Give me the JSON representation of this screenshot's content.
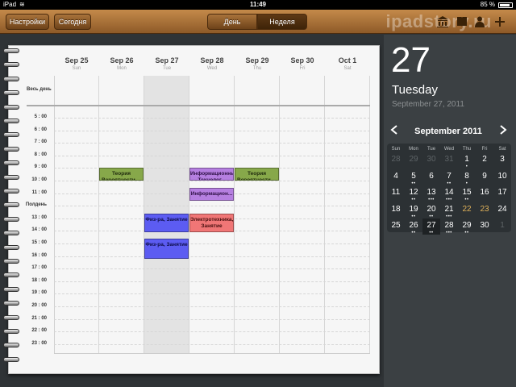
{
  "status": {
    "carrier": "iPad",
    "time": "11:49",
    "battery": "85 %"
  },
  "toolbar": {
    "settings_label": "Настройки",
    "today_label": "Сегодня",
    "day_label": "День",
    "week_label": "Неделя",
    "watermark": "ipadstory.ru"
  },
  "week": {
    "days": [
      {
        "date": "Sep 25",
        "name": "Sun"
      },
      {
        "date": "Sep 26",
        "name": "Mon"
      },
      {
        "date": "Sep 27",
        "name": "Tue"
      },
      {
        "date": "Sep 28",
        "name": "Wed"
      },
      {
        "date": "Sep 29",
        "name": "Thu"
      },
      {
        "date": "Sep 30",
        "name": "Fri"
      },
      {
        "date": "Oct 1",
        "name": "Sat"
      }
    ],
    "allday_label": "Весь день",
    "hours": [
      "5 : 00",
      "6 : 00",
      "7 : 00",
      "8 : 00",
      "9 : 00",
      "10 : 00",
      "11 : 00",
      "Полдень",
      "13 : 00",
      "14 : 00",
      "15 : 00",
      "16 : 00",
      "17 : 00",
      "18 : 00",
      "19 : 00",
      "20 : 00",
      "21 : 00",
      "22 : 00",
      "23 : 00"
    ],
    "events": [
      {
        "title": "Теория Вероятности,...",
        "day": 1,
        "start": 9,
        "end": 10,
        "color": "green"
      },
      {
        "title": "Информационные Технолог...",
        "day": 3,
        "start": 9,
        "end": 10,
        "color": "purple"
      },
      {
        "title": "Теория Вероятности,...",
        "day": 4,
        "start": 9,
        "end": 10,
        "color": "green"
      },
      {
        "title": "Информацион...",
        "day": 3,
        "start": 10.6,
        "end": 11.6,
        "color": "purple"
      },
      {
        "title": "Физ-ра, Занятие",
        "day": 2,
        "start": 12.6,
        "end": 14.1,
        "color": "blue"
      },
      {
        "title": "Электротехника, Занятие",
        "day": 3,
        "start": 12.6,
        "end": 14.1,
        "color": "red"
      },
      {
        "title": "Физ-ра, Занятие",
        "day": 2,
        "start": 14.6,
        "end": 16.2,
        "color": "blue"
      }
    ]
  },
  "sidebar": {
    "day_number": "27",
    "weekday": "Tuesday",
    "full_date": "September 27, 2011",
    "month_title": "September 2011",
    "weekdays": [
      "Sun",
      "Mon",
      "Tue",
      "Wed",
      "Thu",
      "Fri",
      "Sat"
    ],
    "weeks": [
      [
        {
          "d": "28",
          "dim": true
        },
        {
          "d": "29",
          "dim": true
        },
        {
          "d": "30",
          "dim": true
        },
        {
          "d": "31",
          "dim": true
        },
        {
          "d": "1",
          "dots": 1
        },
        {
          "d": "2"
        },
        {
          "d": "3"
        }
      ],
      [
        {
          "d": "4"
        },
        {
          "d": "5",
          "dots": 2
        },
        {
          "d": "6"
        },
        {
          "d": "7",
          "dots": 2
        },
        {
          "d": "8",
          "dots": 1
        },
        {
          "d": "9"
        },
        {
          "d": "10"
        }
      ],
      [
        {
          "d": "11"
        },
        {
          "d": "12",
          "dots": 2
        },
        {
          "d": "13",
          "dots": 3
        },
        {
          "d": "14",
          "dots": 3
        },
        {
          "d": "15",
          "dots": 2
        },
        {
          "d": "16"
        },
        {
          "d": "17"
        }
      ],
      [
        {
          "d": "18"
        },
        {
          "d": "19",
          "dots": 2
        },
        {
          "d": "20",
          "dots": 2
        },
        {
          "d": "21",
          "dots": 3
        },
        {
          "d": "22",
          "accent": true
        },
        {
          "d": "23",
          "accent": true
        },
        {
          "d": "24"
        }
      ],
      [
        {
          "d": "25"
        },
        {
          "d": "26",
          "dots": 2
        },
        {
          "d": "27",
          "today": true,
          "dots": 2
        },
        {
          "d": "28",
          "dots": 3
        },
        {
          "d": "29",
          "dots": 2
        },
        {
          "d": "30"
        },
        {
          "d": "1",
          "dim": true
        }
      ]
    ]
  }
}
